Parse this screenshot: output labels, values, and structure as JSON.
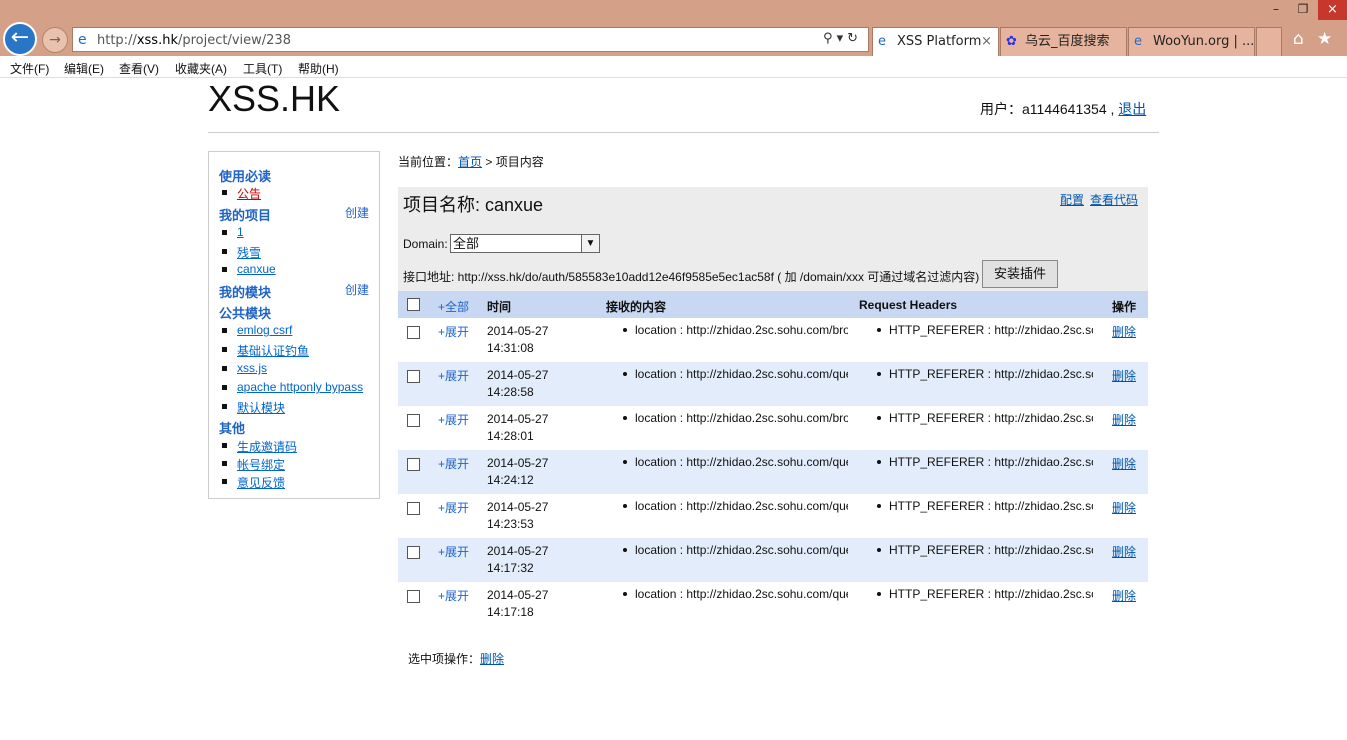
{
  "browser": {
    "url_prefix": "http://",
    "url_host": "xss.hk",
    "url_path": "/project/view/238",
    "tabs": [
      {
        "label": "XSS Platform",
        "active": true
      },
      {
        "label": "乌云_百度搜索",
        "active": false
      },
      {
        "label": "WooYun.org | ...",
        "active": false
      }
    ],
    "menu": [
      "文件(F)",
      "编辑(E)",
      "查看(V)",
      "收藏夹(A)",
      "工具(T)",
      "帮助(H)"
    ]
  },
  "header": {
    "logo": "XSS.HK",
    "user_prefix": "用户：a1144641354 , ",
    "logout": "退出"
  },
  "sidebar": {
    "sections": [
      {
        "title": "使用必读",
        "items": [
          {
            "label": "公告",
            "red": true
          }
        ]
      },
      {
        "title": "我的项目",
        "create": "创建",
        "items": [
          {
            "label": "1"
          },
          {
            "label": "残雪"
          },
          {
            "label": "canxue"
          }
        ]
      },
      {
        "title": "我的模块",
        "create": "创建",
        "items": []
      },
      {
        "title": "公共模块",
        "items": [
          {
            "label": "emlog csrf"
          },
          {
            "label": "基础认证钓鱼"
          },
          {
            "label": "xss.js"
          },
          {
            "label": "apache httponly bypass"
          },
          {
            "label": "默认模块"
          }
        ]
      },
      {
        "title": "其他",
        "items": [
          {
            "label": "生成邀请码"
          },
          {
            "label": "帐号绑定"
          },
          {
            "label": "意见反馈"
          }
        ]
      }
    ]
  },
  "breadcrumb": {
    "prefix": "当前位置：",
    "home": "首页",
    "current": " > 项目内容"
  },
  "project": {
    "title": "项目名称: canxue",
    "config_link": "配置",
    "code_link": "查看代码",
    "domain_label": "Domain:",
    "domain_value": "全部",
    "api_text": "接口地址: http://xss.hk/do/auth/585583e10add12e46f9585e5ec1ac58f ( 加 /domain/xxx 可通过域名过滤内容)",
    "install_button": "安装插件"
  },
  "table": {
    "headers": {
      "all": "+全部",
      "time": "时间",
      "content": "接收的内容",
      "request_headers": "Request Headers",
      "action": "操作"
    },
    "rows": [
      {
        "expand": "+展开",
        "date": "2014-05-27",
        "time": "14:31:08",
        "content": "location : http://zhidao.2sc.sohu.com/bro",
        "headers": "HTTP_REFERER : http://zhidao.2sc.soh",
        "delete": "删除"
      },
      {
        "expand": "+展开",
        "date": "2014-05-27",
        "time": "14:28:58",
        "content": "location : http://zhidao.2sc.sohu.com/que",
        "headers": "HTTP_REFERER : http://zhidao.2sc.soh",
        "delete": "删除"
      },
      {
        "expand": "+展开",
        "date": "2014-05-27",
        "time": "14:28:01",
        "content": "location : http://zhidao.2sc.sohu.com/bro",
        "headers": "HTTP_REFERER : http://zhidao.2sc.soh",
        "delete": "删除"
      },
      {
        "expand": "+展开",
        "date": "2014-05-27",
        "time": "14:24:12",
        "content": "location : http://zhidao.2sc.sohu.com/que",
        "headers": "HTTP_REFERER : http://zhidao.2sc.soh",
        "delete": "删除"
      },
      {
        "expand": "+展开",
        "date": "2014-05-27",
        "time": "14:23:53",
        "content": "location : http://zhidao.2sc.sohu.com/que",
        "headers": "HTTP_REFERER : http://zhidao.2sc.soh",
        "delete": "删除"
      },
      {
        "expand": "+展开",
        "date": "2014-05-27",
        "time": "14:17:32",
        "content": "location : http://zhidao.2sc.sohu.com/que",
        "headers": "HTTP_REFERER : http://zhidao.2sc.soh",
        "delete": "删除"
      },
      {
        "expand": "+展开",
        "date": "2014-05-27",
        "time": "14:17:18",
        "content": "location : http://zhidao.2sc.sohu.com/que",
        "headers": "HTTP_REFERER : http://zhidao.2sc.soh",
        "delete": "删除"
      }
    ]
  },
  "bulk": {
    "label": "选中项操作：",
    "delete": "删除"
  }
}
